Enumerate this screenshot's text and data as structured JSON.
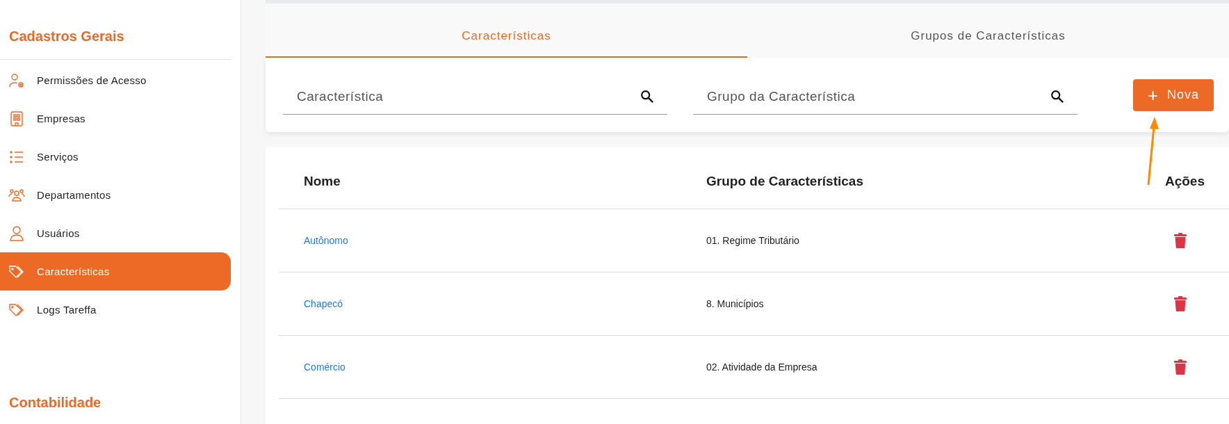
{
  "sidebar": {
    "sections": [
      {
        "title": "Cadastros Gerais",
        "items": [
          {
            "label": "Permissões de Acesso",
            "selected": false
          },
          {
            "label": "Empresas",
            "selected": false
          },
          {
            "label": "Serviços",
            "selected": false
          },
          {
            "label": "Departamentos",
            "selected": false
          },
          {
            "label": "Usuários",
            "selected": false
          },
          {
            "label": "Características",
            "selected": true
          },
          {
            "label": "Logs Tareffa",
            "selected": false
          }
        ]
      },
      {
        "title": "Contabilidade"
      }
    ]
  },
  "tabs": [
    {
      "label": "Características",
      "selected": true
    },
    {
      "label": "Grupos de Características",
      "selected": false
    }
  ],
  "filters": [
    {
      "placeholder": "Característica"
    },
    {
      "placeholder": "Grupo da Característica"
    }
  ],
  "new_button": {
    "icon": "+",
    "label": "Nova"
  },
  "table": {
    "columns": [
      "Nome",
      "Grupo de Características",
      "Ações"
    ],
    "rows": [
      {
        "name": "Autônomo",
        "group": "01. Regime Tributário"
      },
      {
        "name": "Chapecó",
        "group": "8. Municípios"
      },
      {
        "name": "Comércio",
        "group": "02. Atividade da Empresa"
      }
    ]
  }
}
